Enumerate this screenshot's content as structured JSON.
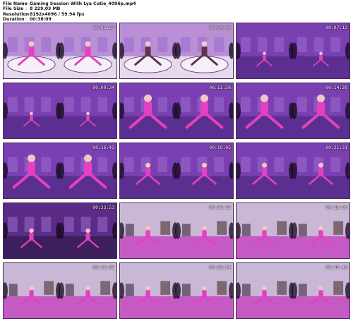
{
  "meta": [
    {
      "label": "File Name",
      "sep": ":",
      "value": "Gaming Session With Lya Cutie_4096p.mp4"
    },
    {
      "label": "File Size",
      "sep": ":",
      "value": "8 229,03 MB"
    },
    {
      "label": "Resolution",
      "sep": ":",
      "value": "8192x4096 / 59.94 fps"
    },
    {
      "label": "Duration",
      "sep": ":",
      "value": "00:38:09"
    }
  ],
  "thumbnails": [
    {
      "timestamp": "00:02:27",
      "scene": "bath"
    },
    {
      "timestamp": "00:04:49",
      "scene": "bath-dark"
    },
    {
      "timestamp": "00:07:12",
      "scene": "room-far"
    },
    {
      "timestamp": "00:09:34",
      "scene": "room-lying"
    },
    {
      "timestamp": "00:11:58",
      "scene": "room-close"
    },
    {
      "timestamp": "00:14:20",
      "scene": "room-close"
    },
    {
      "timestamp": "00:16:42",
      "scene": "room-close"
    },
    {
      "timestamp": "00:19:05",
      "scene": "room-mid"
    },
    {
      "timestamp": "00:21:31",
      "scene": "room-mid"
    },
    {
      "timestamp": "00:23:53",
      "scene": "room-dark"
    },
    {
      "timestamp": "00:26:15",
      "scene": "pink-sit"
    },
    {
      "timestamp": "00:28:38",
      "scene": "pink-sit"
    },
    {
      "timestamp": "00:31:02",
      "scene": "pink-lie"
    },
    {
      "timestamp": "00:33:24",
      "scene": "pink-lie"
    },
    {
      "timestamp": "00:35:46",
      "scene": "pink-lie"
    }
  ],
  "palette": {
    "bg_purple": "#7a3fb0",
    "bg_violet": "#5a2f8f",
    "floor_pink": "#c65ac4",
    "figure_pink": "#e63fc0",
    "light_room": "#c9b7d6"
  }
}
